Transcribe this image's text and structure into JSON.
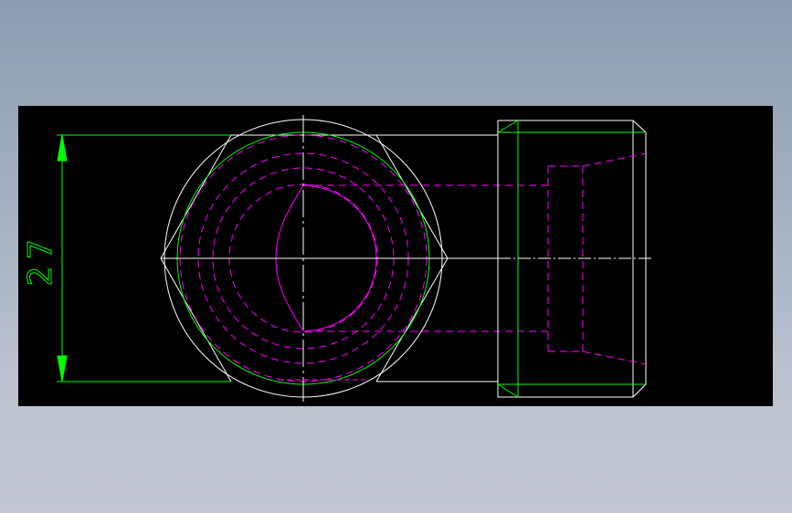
{
  "drawing": {
    "dimension_value": "27",
    "colors": {
      "canvas_background": "#000000",
      "outline": "#ffffff",
      "dimension": "#00ff00",
      "hidden_lines": "#ff00ff"
    }
  }
}
